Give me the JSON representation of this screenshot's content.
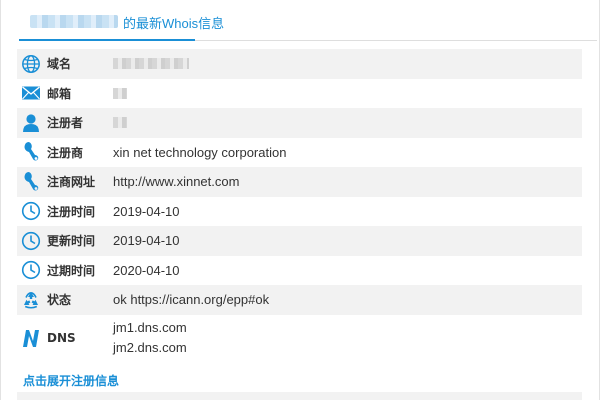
{
  "tab": {
    "title_suffix": "的最新Whois信息"
  },
  "rows": [
    {
      "label": "域名",
      "icon": "globe-icon"
    },
    {
      "label": "邮箱",
      "icon": "mail-icon"
    },
    {
      "label": "注册者",
      "icon": "user-icon"
    },
    {
      "label": "注册商",
      "icon": "registrar-icon",
      "value": "xin net technology corporation"
    },
    {
      "label": "注商网址",
      "icon": "registrar-icon",
      "value": "http://www.xinnet.com"
    },
    {
      "label": "注册时间",
      "icon": "clock-icon",
      "value": "2019-04-10"
    },
    {
      "label": "更新时间",
      "icon": "clock-icon",
      "value": "2019-04-10"
    },
    {
      "label": "过期时间",
      "icon": "clock-icon",
      "value": "2020-04-10"
    },
    {
      "label": "状态",
      "icon": "recycle-icon",
      "value": "ok https://icann.org/epp#ok"
    },
    {
      "label": "DNS",
      "icon": "dns-icon",
      "values": [
        "jm1.dns.com",
        "jm2.dns.com"
      ]
    }
  ],
  "expand_link": "点击展开注册信息",
  "colors": {
    "accent": "#1a8fd6",
    "row_shade": "#f2f2f2",
    "text": "#333333"
  }
}
